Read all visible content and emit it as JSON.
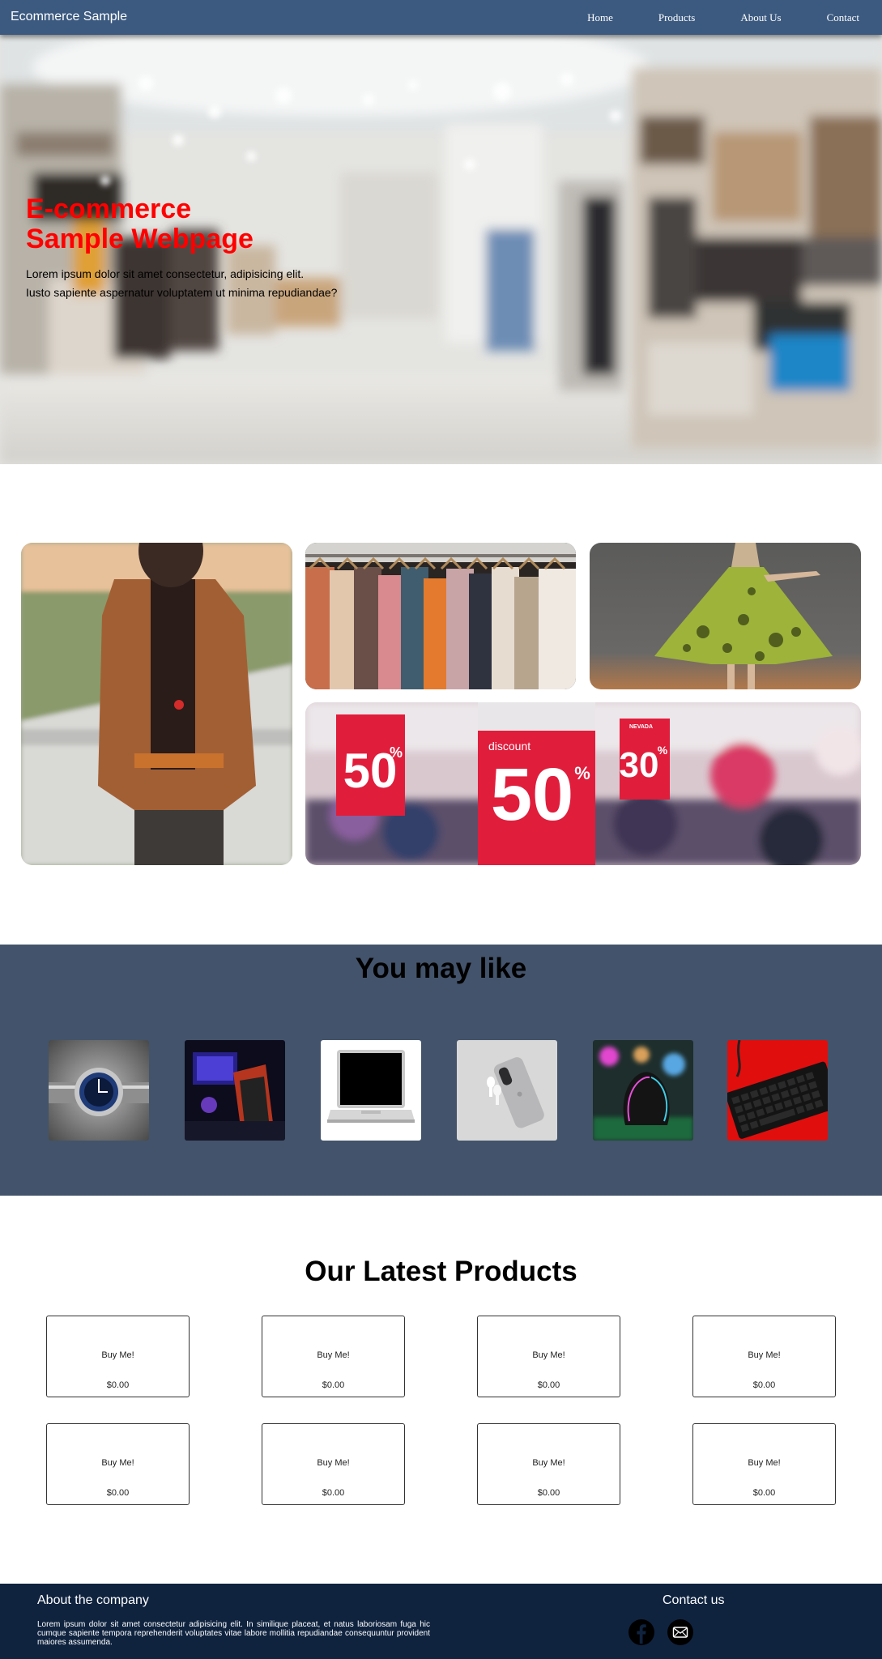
{
  "navbar": {
    "brand": "Ecommerce Sample",
    "links": [
      "Home",
      "Products",
      "About Us",
      "Contact"
    ]
  },
  "hero": {
    "title": "E-commerce\nSample Webpage",
    "line1": "Lorem ipsum dolor sit amet consectetur, adipisicing elit.",
    "line2": "Iusto sapiente aspernatur voluptatem ut minima repudiandae?"
  },
  "gallery": {
    "sale_tags": [
      {
        "small": "",
        "big": "50",
        "pct": "%"
      },
      {
        "small": "discount",
        "big": "50",
        "pct": "%"
      },
      {
        "small": "NEVADA",
        "big": "30",
        "pct": "%"
      }
    ]
  },
  "may_like": {
    "title": "You may like",
    "items": [
      "watch-icon",
      "gaming-setup-icon",
      "laptop-icon",
      "phone-earbuds-icon",
      "gaming-mouse-icon",
      "keyboard-icon"
    ]
  },
  "latest": {
    "title": "Our Latest Products",
    "products": [
      {
        "label": "Buy Me!",
        "price": "$0.00"
      },
      {
        "label": "Buy Me!",
        "price": "$0.00"
      },
      {
        "label": "Buy Me!",
        "price": "$0.00"
      },
      {
        "label": "Buy Me!",
        "price": "$0.00"
      },
      {
        "label": "Buy Me!",
        "price": "$0.00"
      },
      {
        "label": "Buy Me!",
        "price": "$0.00"
      },
      {
        "label": "Buy Me!",
        "price": "$0.00"
      },
      {
        "label": "Buy Me!",
        "price": "$0.00"
      }
    ]
  },
  "footer": {
    "about_title": "About the company",
    "about_text": "Lorem ipsum dolor sit amet consectetur adipisicing elit. In similique placeat, et natus laboriosam fuga hic cumque sapiente tempora reprehenderit voluptates vitae labore mollitia repudiandae consequuntur provident maiores assumenda.",
    "contact_title": "Contact us",
    "socials": [
      "facebook-icon",
      "mail-icon"
    ]
  },
  "colors": {
    "navbar": "#3c5a80",
    "hero_title": "#ff0000",
    "may_like_bg": "#43536b",
    "footer_bg": "#0f233f"
  }
}
